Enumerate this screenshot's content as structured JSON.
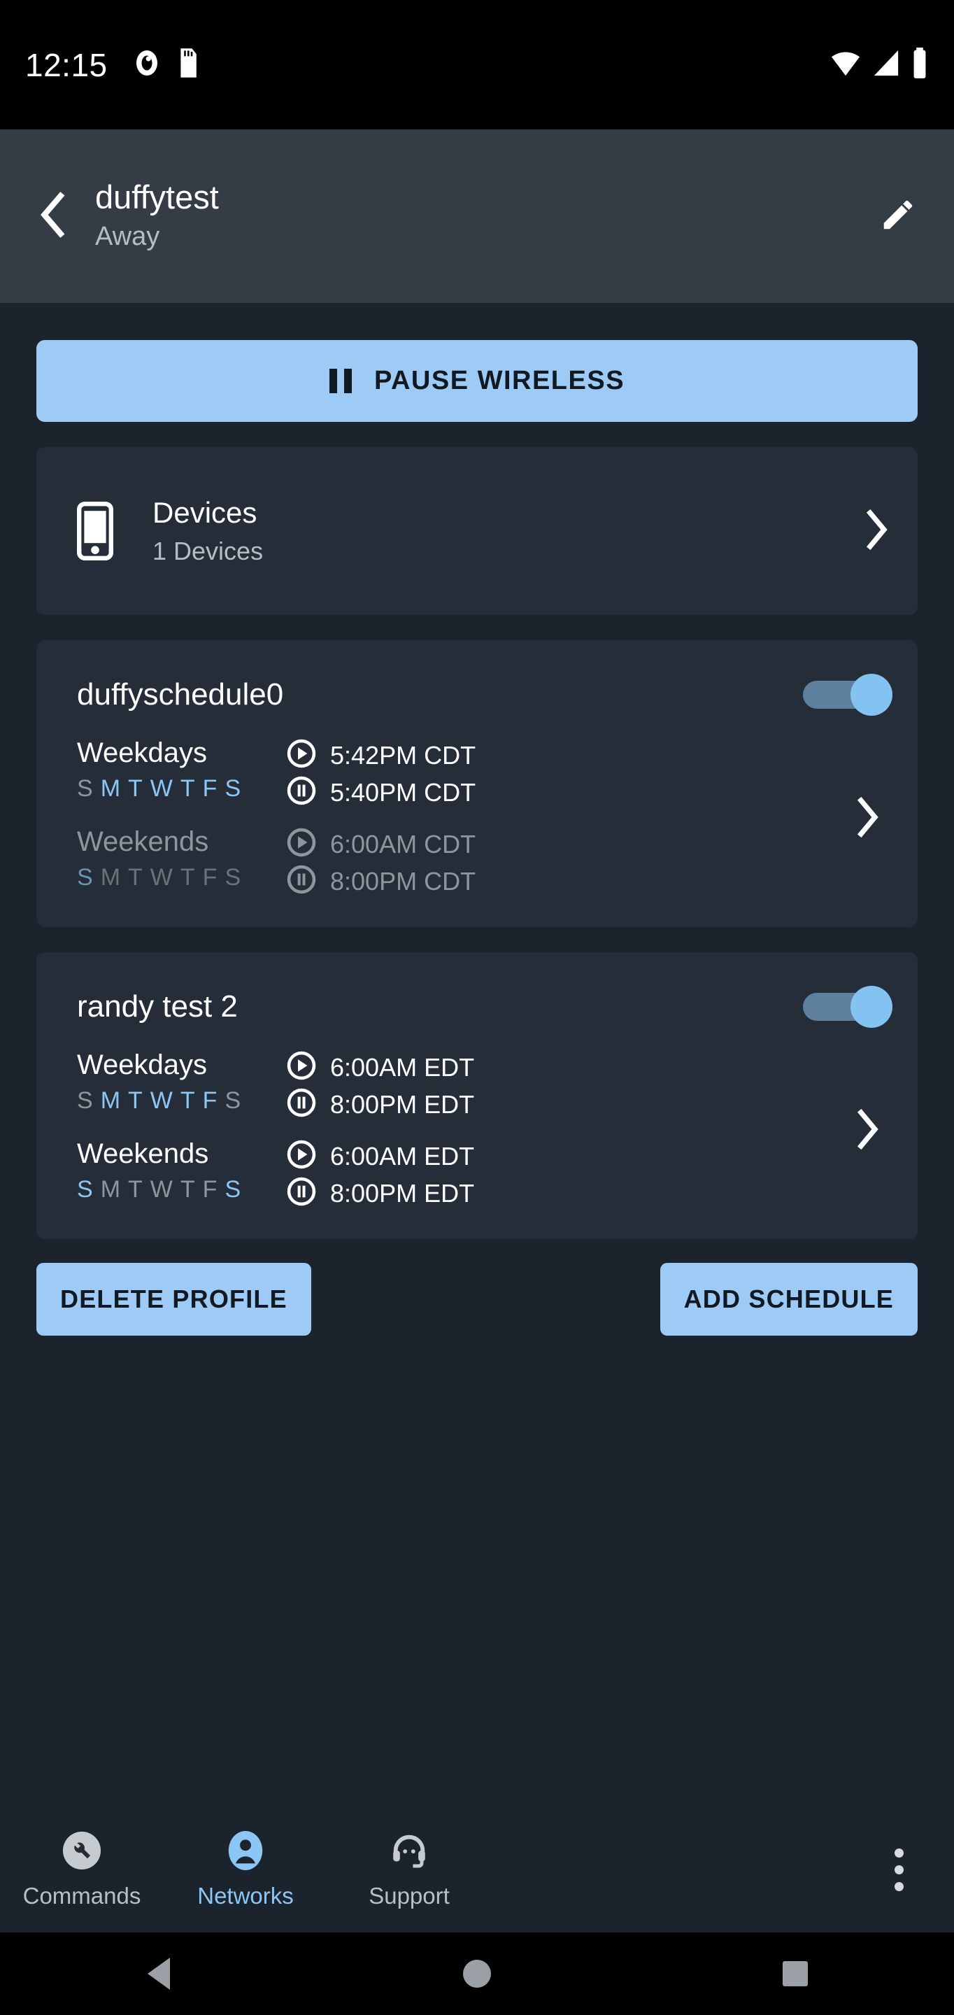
{
  "status_bar": {
    "time": "12:15",
    "left_icons": [
      "screen-record-icon",
      "sd-card-icon"
    ],
    "right_icons": [
      "wifi-icon",
      "cellular-signal-icon",
      "battery-icon"
    ]
  },
  "app_bar": {
    "back_icon": "back-chevron-icon",
    "title": "duffytest",
    "subtitle": "Away",
    "edit_icon": "pencil-edit-icon"
  },
  "pause_button": {
    "label": "PAUSE WIRELESS",
    "icon": "pause-icon",
    "bg_color": "#9dcbf5",
    "text_color": "#111a22"
  },
  "devices_card": {
    "icon": "mobile-phone-icon",
    "title": "Devices",
    "subtitle": "1 Devices",
    "chevron": "chevron-right-icon"
  },
  "schedules": [
    {
      "name": "duffyschedule0",
      "enabled": true,
      "rows": [
        {
          "label": "Weekdays",
          "active": true,
          "days": [
            {
              "letter": "S",
              "on": false
            },
            {
              "letter": "M",
              "on": true
            },
            {
              "letter": "T",
              "on": true
            },
            {
              "letter": "W",
              "on": true
            },
            {
              "letter": "T",
              "on": true
            },
            {
              "letter": "F",
              "on": true
            },
            {
              "letter": "S",
              "on": true
            }
          ],
          "start_icon": "play-circle-icon",
          "start_time": "5:42PM CDT",
          "stop_icon": "pause-circle-icon",
          "stop_time": "5:40PM CDT"
        },
        {
          "label": "Weekends",
          "active": false,
          "days": [
            {
              "letter": "S",
              "on": true
            },
            {
              "letter": "M",
              "on": false
            },
            {
              "letter": "T",
              "on": false
            },
            {
              "letter": "W",
              "on": false
            },
            {
              "letter": "T",
              "on": false
            },
            {
              "letter": "F",
              "on": false
            },
            {
              "letter": "S",
              "on": false
            }
          ],
          "start_icon": "play-circle-icon",
          "start_time": "6:00AM CDT",
          "stop_icon": "pause-circle-icon",
          "stop_time": "8:00PM CDT"
        }
      ],
      "chevron": "chevron-right-icon"
    },
    {
      "name": "randy test 2",
      "enabled": true,
      "rows": [
        {
          "label": "Weekdays",
          "active": true,
          "days": [
            {
              "letter": "S",
              "on": false
            },
            {
              "letter": "M",
              "on": true
            },
            {
              "letter": "T",
              "on": true
            },
            {
              "letter": "W",
              "on": true
            },
            {
              "letter": "T",
              "on": true
            },
            {
              "letter": "F",
              "on": true
            },
            {
              "letter": "S",
              "on": false
            }
          ],
          "start_icon": "play-circle-icon",
          "start_time": "6:00AM EDT",
          "stop_icon": "pause-circle-icon",
          "stop_time": "8:00PM EDT"
        },
        {
          "label": "Weekends",
          "active": true,
          "days": [
            {
              "letter": "S",
              "on": true
            },
            {
              "letter": "M",
              "on": false
            },
            {
              "letter": "T",
              "on": false
            },
            {
              "letter": "W",
              "on": false
            },
            {
              "letter": "T",
              "on": false
            },
            {
              "letter": "F",
              "on": false
            },
            {
              "letter": "S",
              "on": true
            }
          ],
          "start_icon": "play-circle-icon",
          "start_time": "6:00AM EDT",
          "stop_icon": "pause-circle-icon",
          "stop_time": "8:00PM EDT"
        }
      ],
      "chevron": "chevron-right-icon"
    }
  ],
  "actions": {
    "delete_label": "DELETE PROFILE",
    "add_label": "ADD SCHEDULE"
  },
  "bottom_nav": {
    "items": [
      {
        "label": "Commands",
        "icon": "wrench-icon",
        "active": false
      },
      {
        "label": "Networks",
        "icon": "person-icon",
        "active": true
      },
      {
        "label": "Support",
        "icon": "headset-icon",
        "active": false
      }
    ],
    "overflow_icon": "more-vertical-icon",
    "active_color": "#8cc6f4",
    "inactive_color": "#b9bfc5"
  },
  "system_nav": {
    "back_icon": "triangle-back-icon",
    "home_icon": "circle-home-icon",
    "recents_icon": "square-recents-icon"
  }
}
